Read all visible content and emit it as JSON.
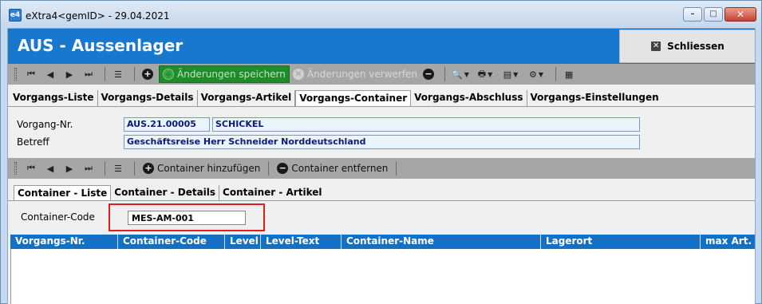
{
  "window": {
    "title": "eXtra4<gemID>  -  29.04.2021",
    "app_icon_text": "e4"
  },
  "header": {
    "title": "AUS - Aussenlager",
    "close_label": "Schliessen"
  },
  "toolbar": {
    "save_label": "Änderungen speichern",
    "discard_label": "Änderungen verwerfen"
  },
  "main_tabs": [
    {
      "label": "Vorgangs-Liste",
      "active": false
    },
    {
      "label": "Vorgangs-Details",
      "active": false
    },
    {
      "label": "Vorgangs-Artikel",
      "active": false
    },
    {
      "label": "Vorgangs-Container",
      "active": true
    },
    {
      "label": "Vorgangs-Abschluss",
      "active": false
    },
    {
      "label": "Vorgangs-Einstellungen",
      "active": false
    }
  ],
  "form": {
    "vorgang_label": "Vorgang-Nr.",
    "vorgang_nr": "AUS.21.00005",
    "vorgang_name": "SCHICKEL",
    "betreff_label": "Betreff",
    "betreff_value": "Geschäftsreise Herr Schneider Norddeutschland"
  },
  "container_toolbar": {
    "add_label": "Container hinzufügen",
    "remove_label": "Container entfernen"
  },
  "sub_tabs": [
    {
      "label": "Container - Liste",
      "active": true
    },
    {
      "label": "Container - Details",
      "active": false
    },
    {
      "label": "Container - Artikel",
      "active": false
    }
  ],
  "container_form": {
    "code_label": "Container-Code",
    "code_value": "MES-AM-001"
  },
  "grid": {
    "columns": [
      "Vorgangs-Nr.",
      "Container-Code",
      "Level",
      "Level-Text",
      "Container-Name",
      "Lagerort",
      "max Art."
    ],
    "rows": []
  },
  "colors": {
    "header_blue": "#1778cd",
    "toolbar_gray": "#a6a6a6",
    "save_green": "#1f8c2c",
    "highlight_red": "#e01c1c"
  }
}
